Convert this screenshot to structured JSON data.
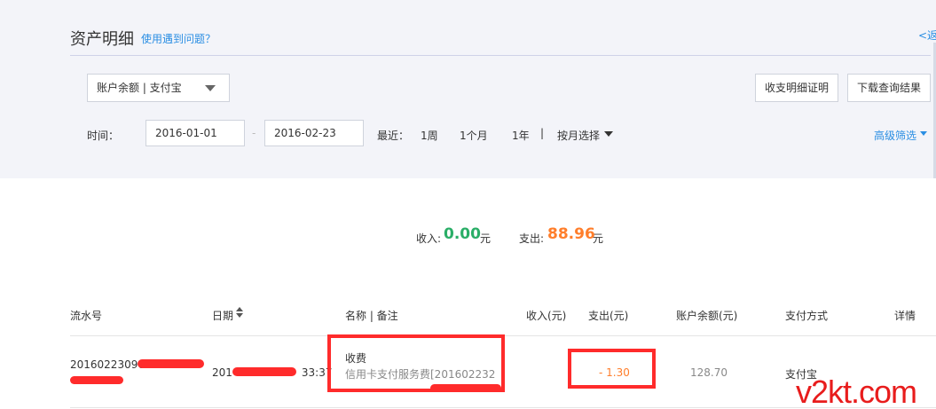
{
  "header": {
    "title": "资产明细",
    "help_link": "使用遇到问题？",
    "back_link": "<返"
  },
  "filters": {
    "account_select": "账户余额 | 支付宝",
    "proof_button": "收支明细证明",
    "download_button": "下载查询结果",
    "time_label": "时间：",
    "date_start": "2016-01-01",
    "date_separator": "-",
    "date_end": "2016-02-23",
    "recent_label": "最近：",
    "quick_week": "1周",
    "quick_month": "1个月",
    "quick_year": "1年",
    "quick_separator": "|",
    "by_month": "按月选择",
    "advanced_filter": "高级筛选"
  },
  "summary": {
    "income_label": "收入:",
    "income_value": "0.00",
    "income_unit": "元",
    "expense_label": "支出:",
    "expense_value": "88.96",
    "expense_unit": "元"
  },
  "table": {
    "columns": {
      "serial": "流水号",
      "date": "日期",
      "name": "名称 | 备注",
      "income": "收入(元)",
      "expense": "支出(元)",
      "balance": "账户余额(元)",
      "method": "支付方式",
      "detail": "详情"
    },
    "rows": [
      {
        "serial_visible": "201602230901",
        "date_prefix": "201",
        "date_suffix": "33:37",
        "name": "收费",
        "memo": "信用卡支付服务费[201602232",
        "income": "",
        "expense": "- 1.30",
        "balance": "128.70",
        "method": "支付宝"
      }
    ]
  },
  "watermark": "v2kt.com",
  "colors": {
    "accent_blue": "#2a8ee3",
    "income_green": "#2aae67",
    "expense_orange": "#ff7e2b",
    "annotation_red": "#ff2b2b"
  }
}
